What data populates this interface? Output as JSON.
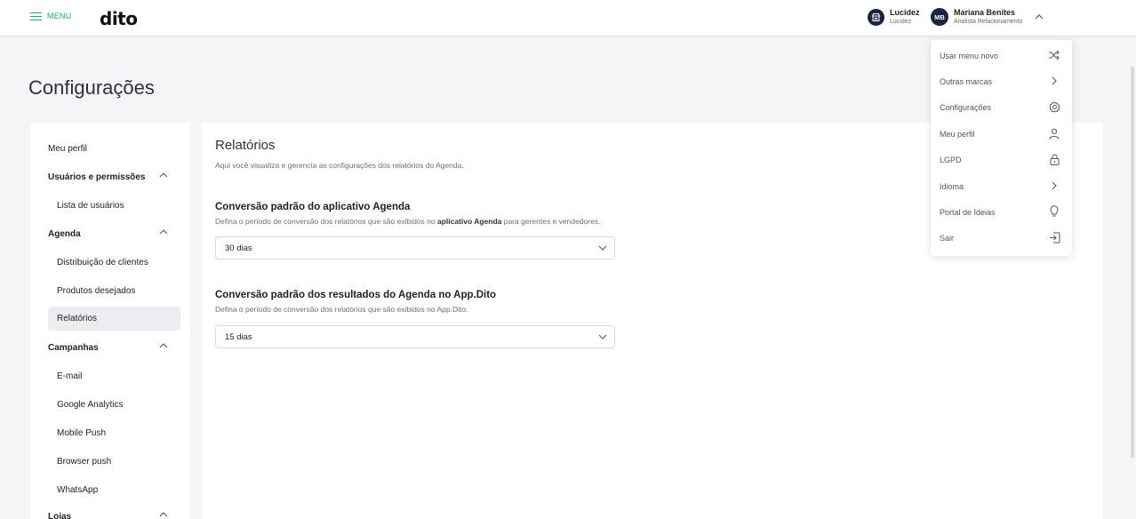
{
  "header": {
    "menu_label": "MENU",
    "logo": "dito",
    "brand": {
      "name": "Lucidez",
      "sub": "Lucidez"
    },
    "user": {
      "initials": "MB",
      "name": "Mariana Benites",
      "role": "Analista Relacionamento"
    }
  },
  "page": {
    "title": "Configurações"
  },
  "sidebar": {
    "items": [
      {
        "label": "Meu perfil"
      },
      {
        "label": "Usuários e permissões"
      },
      {
        "label": "Lista de usuários"
      },
      {
        "label": "Agenda"
      },
      {
        "label": "Distribuição de clientes"
      },
      {
        "label": "Produtos desejados"
      },
      {
        "label": "Relatórios"
      },
      {
        "label": "Campanhas"
      },
      {
        "label": "E-mail"
      },
      {
        "label": "Google Analytics"
      },
      {
        "label": "Mobile Push"
      },
      {
        "label": "Browser push"
      },
      {
        "label": "WhatsApp"
      },
      {
        "label": "Lojas"
      }
    ]
  },
  "main": {
    "title": "Relatórios",
    "description": "Aqui você visualiza e gerencia as configurações dos relatórios do Agenda.",
    "section1": {
      "title": "Conversão padrão do aplicativo Agenda",
      "desc_before": "Defina o período de conversão dos relatórios que são exibidos no ",
      "desc_bold": "aplicativo Agenda",
      "desc_after": " para gerentes e vendedores.",
      "value": "30 dias"
    },
    "section2": {
      "title": "Conversão padrão dos resultados do Agenda no App.Dito",
      "description": "Defina o período de conversão dos relatórios que são exibidos no App.Dito.",
      "value": "15 dias"
    }
  },
  "user_menu": {
    "items": [
      {
        "label": "Usar menu novo",
        "icon": "shuffle-icon"
      },
      {
        "label": "Outras marcas",
        "icon": "chevron-right-icon"
      },
      {
        "label": "Configurações",
        "icon": "gear-icon"
      },
      {
        "label": "Meu perfil",
        "icon": "user-icon"
      },
      {
        "label": "LGPD",
        "icon": "lock-icon"
      },
      {
        "label": "Idioma",
        "icon": "chevron-right-icon"
      },
      {
        "label": "Portal de Ideias",
        "icon": "lightbulb-icon"
      },
      {
        "label": "Sair",
        "icon": "logout-icon"
      }
    ]
  },
  "colors": {
    "accent": "#17b26a",
    "navy": "#1b2341",
    "active_bg": "#ececf1"
  }
}
